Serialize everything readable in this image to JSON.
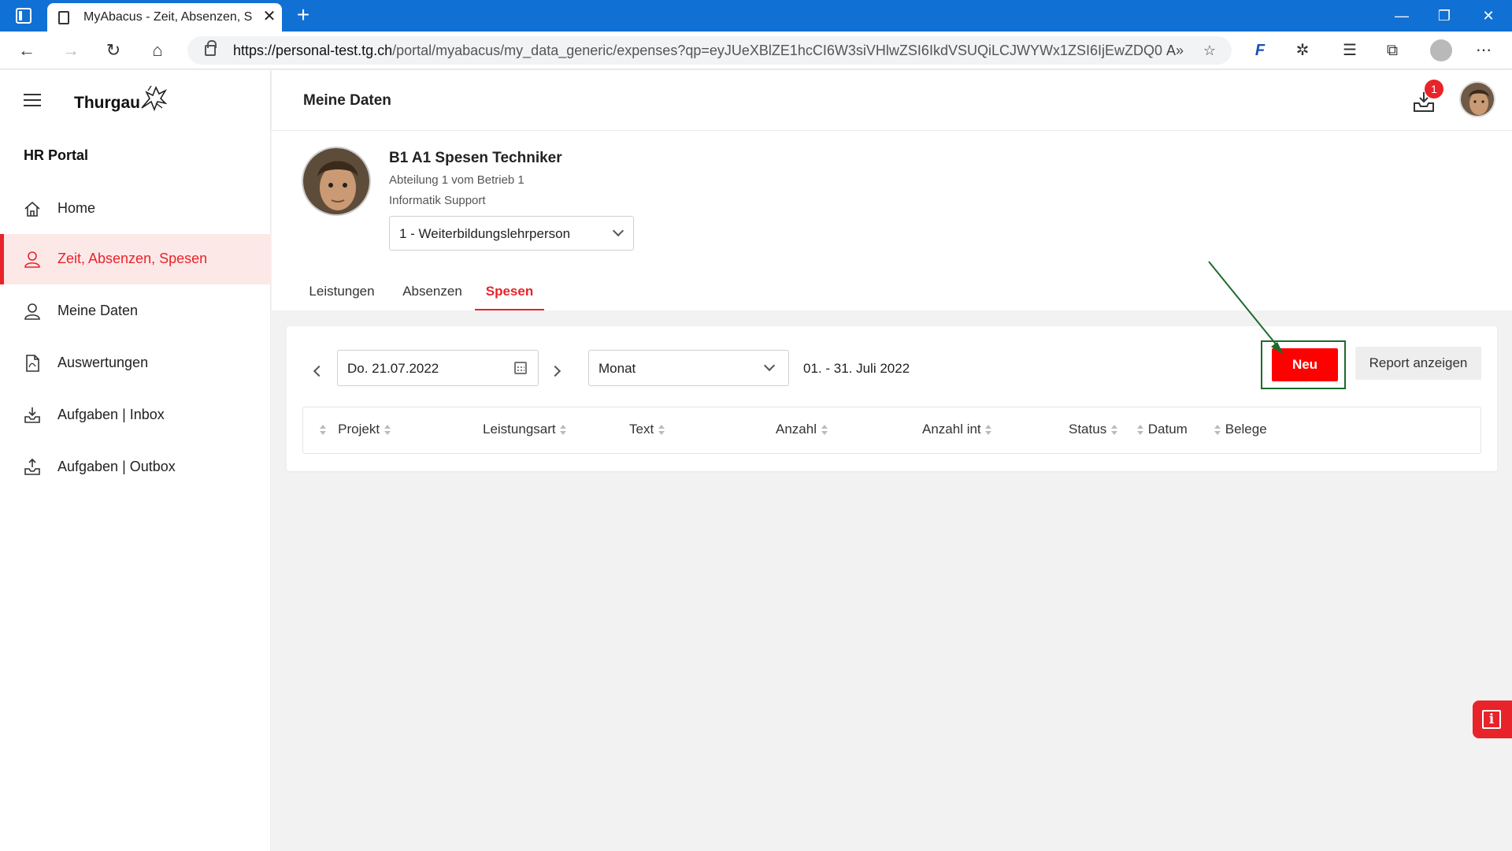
{
  "browser": {
    "tab_title": "MyAbacus - Zeit, Absenzen, Spesen",
    "tab_close": "✕",
    "new_tab": "+",
    "url_host": "https://personal-test.tg.ch",
    "url_path": "/portal/myabacus/my_data_generic/expenses?qp=eyJUeXBlZE1hcCI6W3siVHlwZSI6IkdVSUQiLCJWYWx1ZSI6IjEwZDQ0NjMzL...",
    "win_min": "—",
    "win_max": "❐",
    "win_close": "✕"
  },
  "sidebar": {
    "logo_text": "Thurgau",
    "portal_title": "HR Portal",
    "items": [
      {
        "label": "Home"
      },
      {
        "label": "Zeit, Absenzen, Spesen"
      },
      {
        "label": "Meine Daten"
      },
      {
        "label": "Auswertungen"
      },
      {
        "label": "Aufgaben | Inbox"
      },
      {
        "label": "Aufgaben | Outbox"
      }
    ]
  },
  "header": {
    "title": "Meine Daten",
    "notification_count": "1"
  },
  "profile": {
    "name": "B1 A1 Spesen Techniker",
    "department": "Abteilung 1 vom Betrieb 1",
    "unit": "Informatik Support",
    "contract_select": "1 - Weiterbildungslehrperson"
  },
  "tabs": [
    {
      "label": "Leistungen"
    },
    {
      "label": "Absenzen"
    },
    {
      "label": "Spesen"
    }
  ],
  "filters": {
    "date": "Do. 21.07.2022",
    "period": "Monat",
    "range": "01. - 31. Juli 2022"
  },
  "actions": {
    "new_label": "Neu",
    "report_label": "Report anzeigen"
  },
  "table": {
    "columns": [
      "Projekt",
      "Leistungsart",
      "Text",
      "Anzahl",
      "Anzahl int",
      "Status",
      "Datum",
      "Belege"
    ]
  },
  "info_fab": {
    "glyph": "i"
  },
  "colors": {
    "brand_red": "#e8232a",
    "button_red": "#ff0000",
    "browser_blue": "#1170d3",
    "annotation_green": "#1c6b2b"
  }
}
